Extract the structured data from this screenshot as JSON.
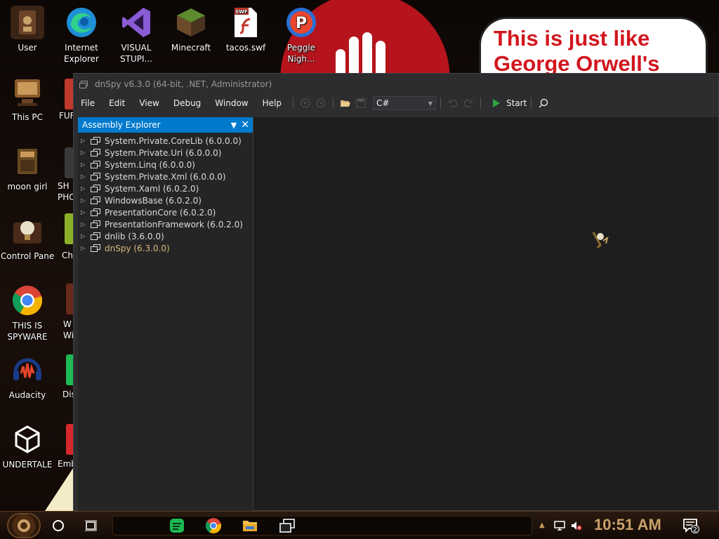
{
  "desktop": {
    "icons": [
      {
        "label": "User",
        "icon": "user-folder-icon",
        "color": "#5a3a26"
      },
      {
        "label": "Internet\nExplorer",
        "icon": "edge-icon",
        "color": "#1e8fd6"
      },
      {
        "label": "VISUAL\nSTUPI...",
        "icon": "visual-studio-icon",
        "color": "#8a5bd6"
      },
      {
        "label": "Minecraft",
        "icon": "minecraft-icon",
        "color": "#4a6b2a"
      },
      {
        "label": "tacos.swf",
        "icon": "flash-file-icon",
        "color": "#ffffff"
      },
      {
        "label": "Peggle\nNigh...",
        "icon": "peggle-icon",
        "color": "#2a6fd6"
      },
      {
        "label": "This PC",
        "icon": "computer-icon",
        "color": "#8a5a2a"
      },
      {
        "label": "moon girl",
        "icon": "folder-icon",
        "color": "#6a4a22"
      },
      {
        "label": "Control Panel",
        "icon": "lightbulb-icon",
        "color": "#4a3a2a"
      },
      {
        "label": "THIS IS\nSPYWARE",
        "icon": "chrome-icon",
        "color": "#db4437"
      },
      {
        "label": "Audacity",
        "icon": "audacity-icon",
        "color": "#1a3a8a"
      },
      {
        "label": "UNDERTALE",
        "icon": "unity-icon",
        "color": "#202020"
      }
    ],
    "partial_labels": [
      "FUF",
      "SH\nPHO",
      "Cho",
      "W\nWi",
      "Dis",
      "Emb"
    ],
    "meme_text": "This is just like\nGeorge Orwell's",
    "colors": {
      "meme_text": "#d2161e",
      "wallpaper_circle": "#b5141c"
    }
  },
  "dnspy": {
    "title": "dnSpy v6.3.0 (64-bit, .NET, Administrator)",
    "menu": [
      "File",
      "Edit",
      "View",
      "Debug",
      "Window",
      "Help"
    ],
    "language": "C#",
    "start_label": "Start",
    "explorer": {
      "title": "Assembly Explorer",
      "assemblies": [
        {
          "name": "System.Private.CoreLib (6.0.0.0)",
          "highlight": false
        },
        {
          "name": "System.Private.Uri (6.0.0.0)",
          "highlight": false
        },
        {
          "name": "System.Linq (6.0.0.0)",
          "highlight": false
        },
        {
          "name": "System.Private.Xml (6.0.0.0)",
          "highlight": false
        },
        {
          "name": "System.Xaml (6.0.2.0)",
          "highlight": false
        },
        {
          "name": "WindowsBase (6.0.2.0)",
          "highlight": false
        },
        {
          "name": "PresentationCore (6.0.2.0)",
          "highlight": false
        },
        {
          "name": "PresentationFramework (6.0.2.0)",
          "highlight": false
        },
        {
          "name": "dnlib (3.6.0.0)",
          "highlight": false
        },
        {
          "name": "dnSpy (6.3.0.0)",
          "highlight": true
        }
      ]
    },
    "colors": {
      "accent": "#007acc",
      "background": "#1e1e1e",
      "highlight_text": "#d7ba7d"
    }
  },
  "taskbar": {
    "clock": "10:51 AM",
    "notification_count": "2",
    "pinned": [
      "spotify-icon",
      "chrome-icon",
      "file-explorer-icon",
      "dnspy-icon"
    ]
  }
}
